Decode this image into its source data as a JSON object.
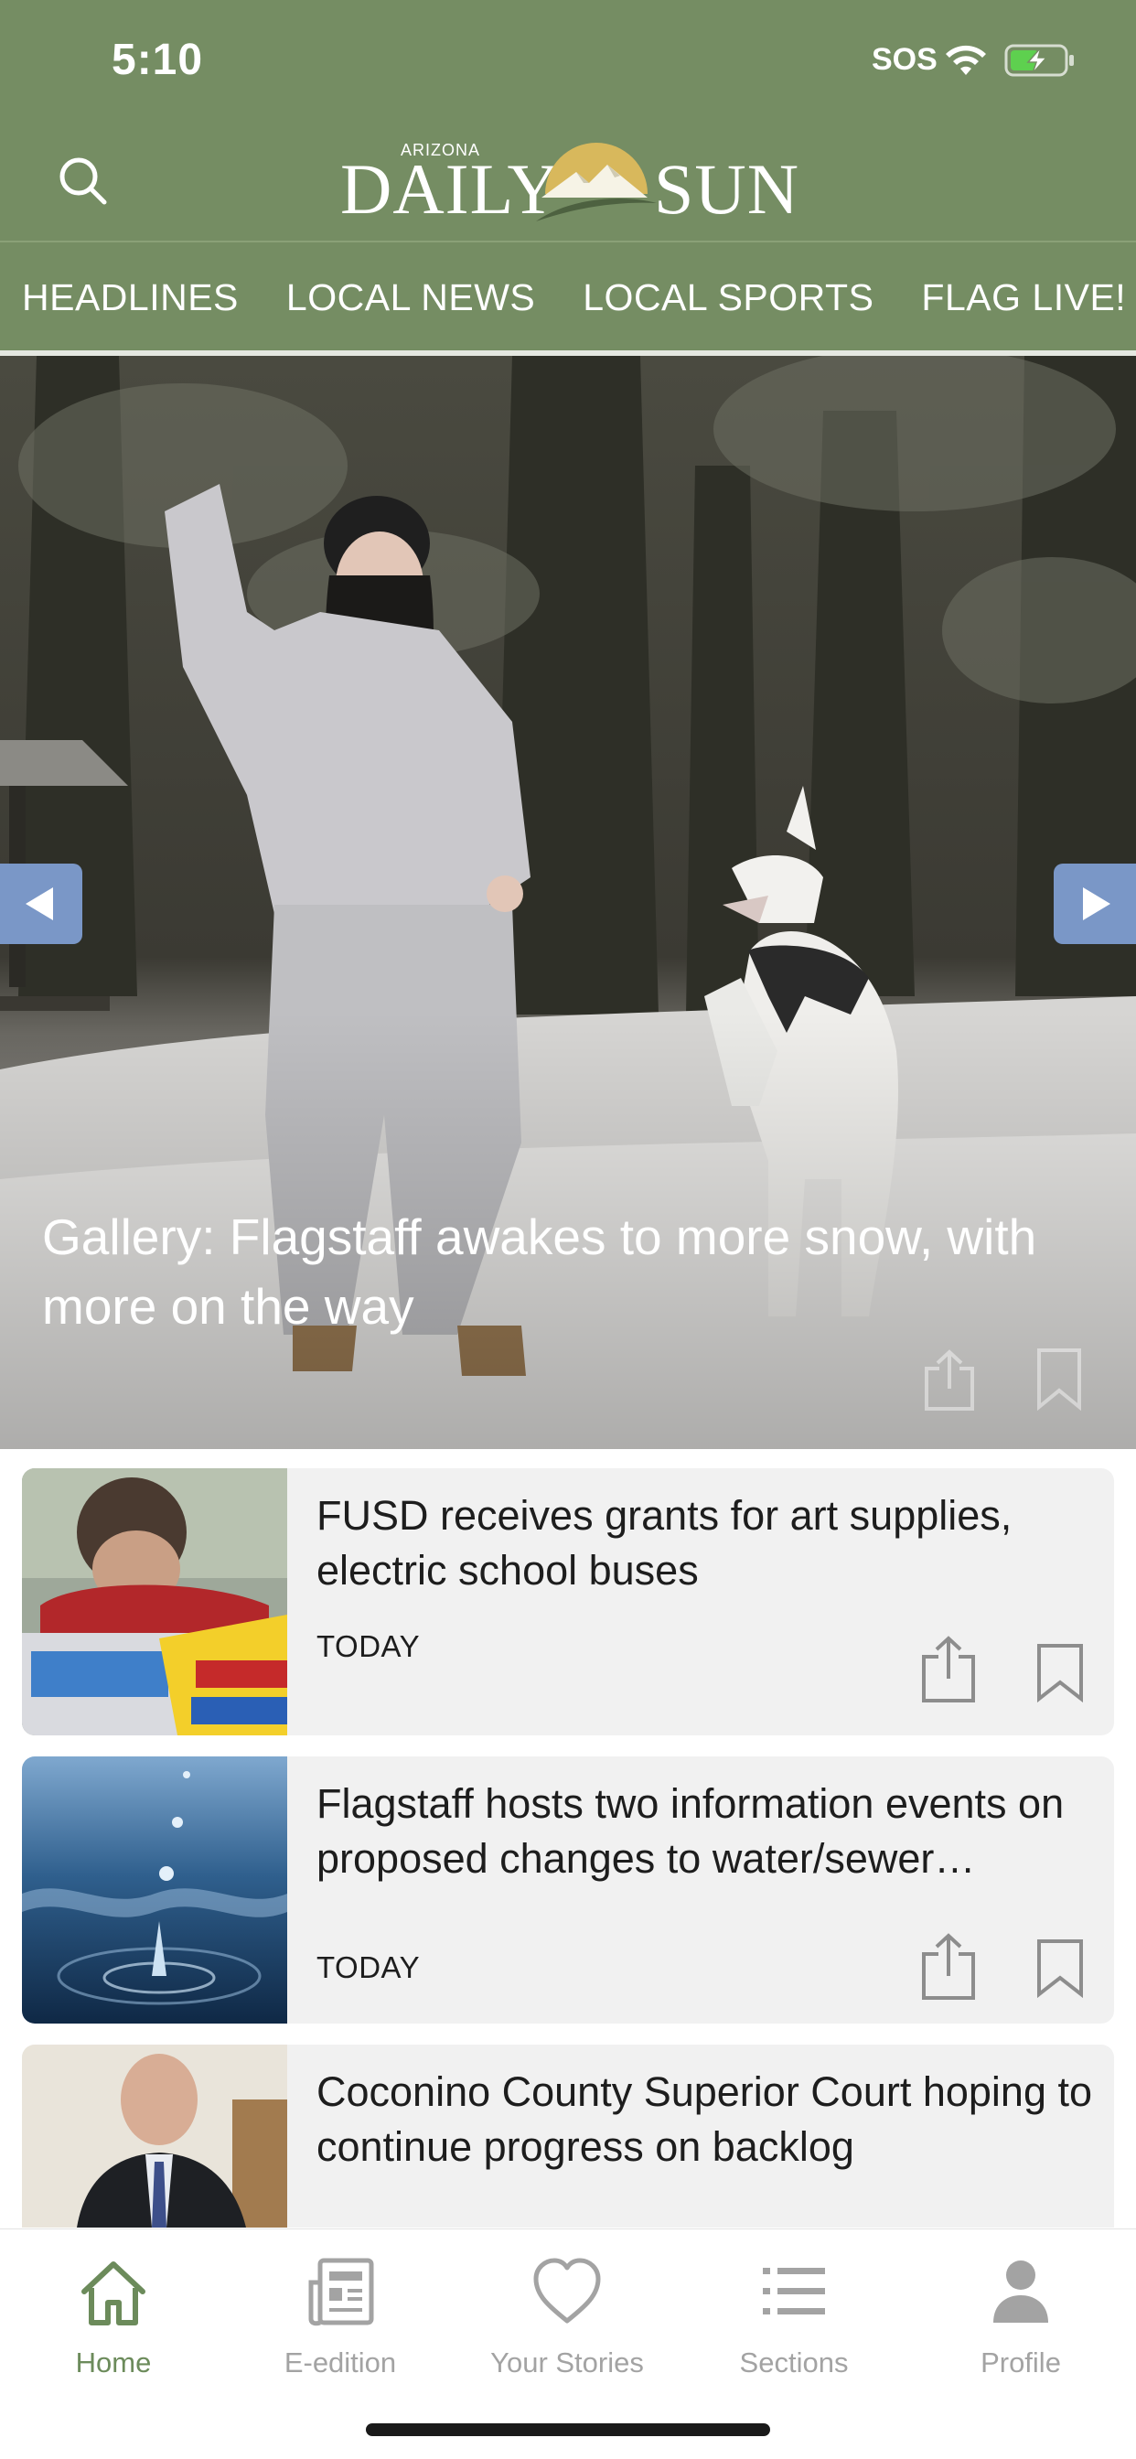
{
  "status_bar": {
    "time": "5:10",
    "sos": "SOS",
    "wifi_icon": "wifi-icon",
    "battery_icon": "battery-charging-icon"
  },
  "header": {
    "search_icon": "search-icon",
    "logo": {
      "small_text": "ARIZONA",
      "left_text": "DAILY",
      "right_text": "SUN"
    },
    "background_color": "#758d63"
  },
  "nav": {
    "tabs": [
      "HEADLINES",
      "LOCAL NEWS",
      "LOCAL SPORTS",
      "FLAG LIVE!"
    ]
  },
  "hero": {
    "title": "Gallery: Flagstaff awakes to more snow, with more on the way",
    "prev_icon": "chevron-left-icon",
    "next_icon": "chevron-right-icon",
    "share_icon": "share-icon",
    "bookmark_icon": "bookmark-icon"
  },
  "articles": [
    {
      "title": "FUSD receives grants for art supplies, electric school buses",
      "date": "TODAY",
      "thumbnail": "child-with-crayons-photo"
    },
    {
      "title": "Flagstaff hosts two information events on proposed changes to water/sewer…",
      "date": "TODAY",
      "thumbnail": "water-drop-photo"
    },
    {
      "title": "Coconino County Superior Court hoping to continue progress on backlog",
      "date": "",
      "thumbnail": "man-in-suit-photo"
    }
  ],
  "tab_bar": {
    "items": [
      {
        "label": "Home",
        "icon": "home-icon"
      },
      {
        "label": "E-edition",
        "icon": "newspaper-icon"
      },
      {
        "label": "Your Stories",
        "icon": "heart-icon"
      },
      {
        "label": "Sections",
        "icon": "list-icon"
      },
      {
        "label": "Profile",
        "icon": "person-icon"
      }
    ],
    "active_color": "#6c8b5b",
    "inactive_color": "#a3a3a3"
  }
}
